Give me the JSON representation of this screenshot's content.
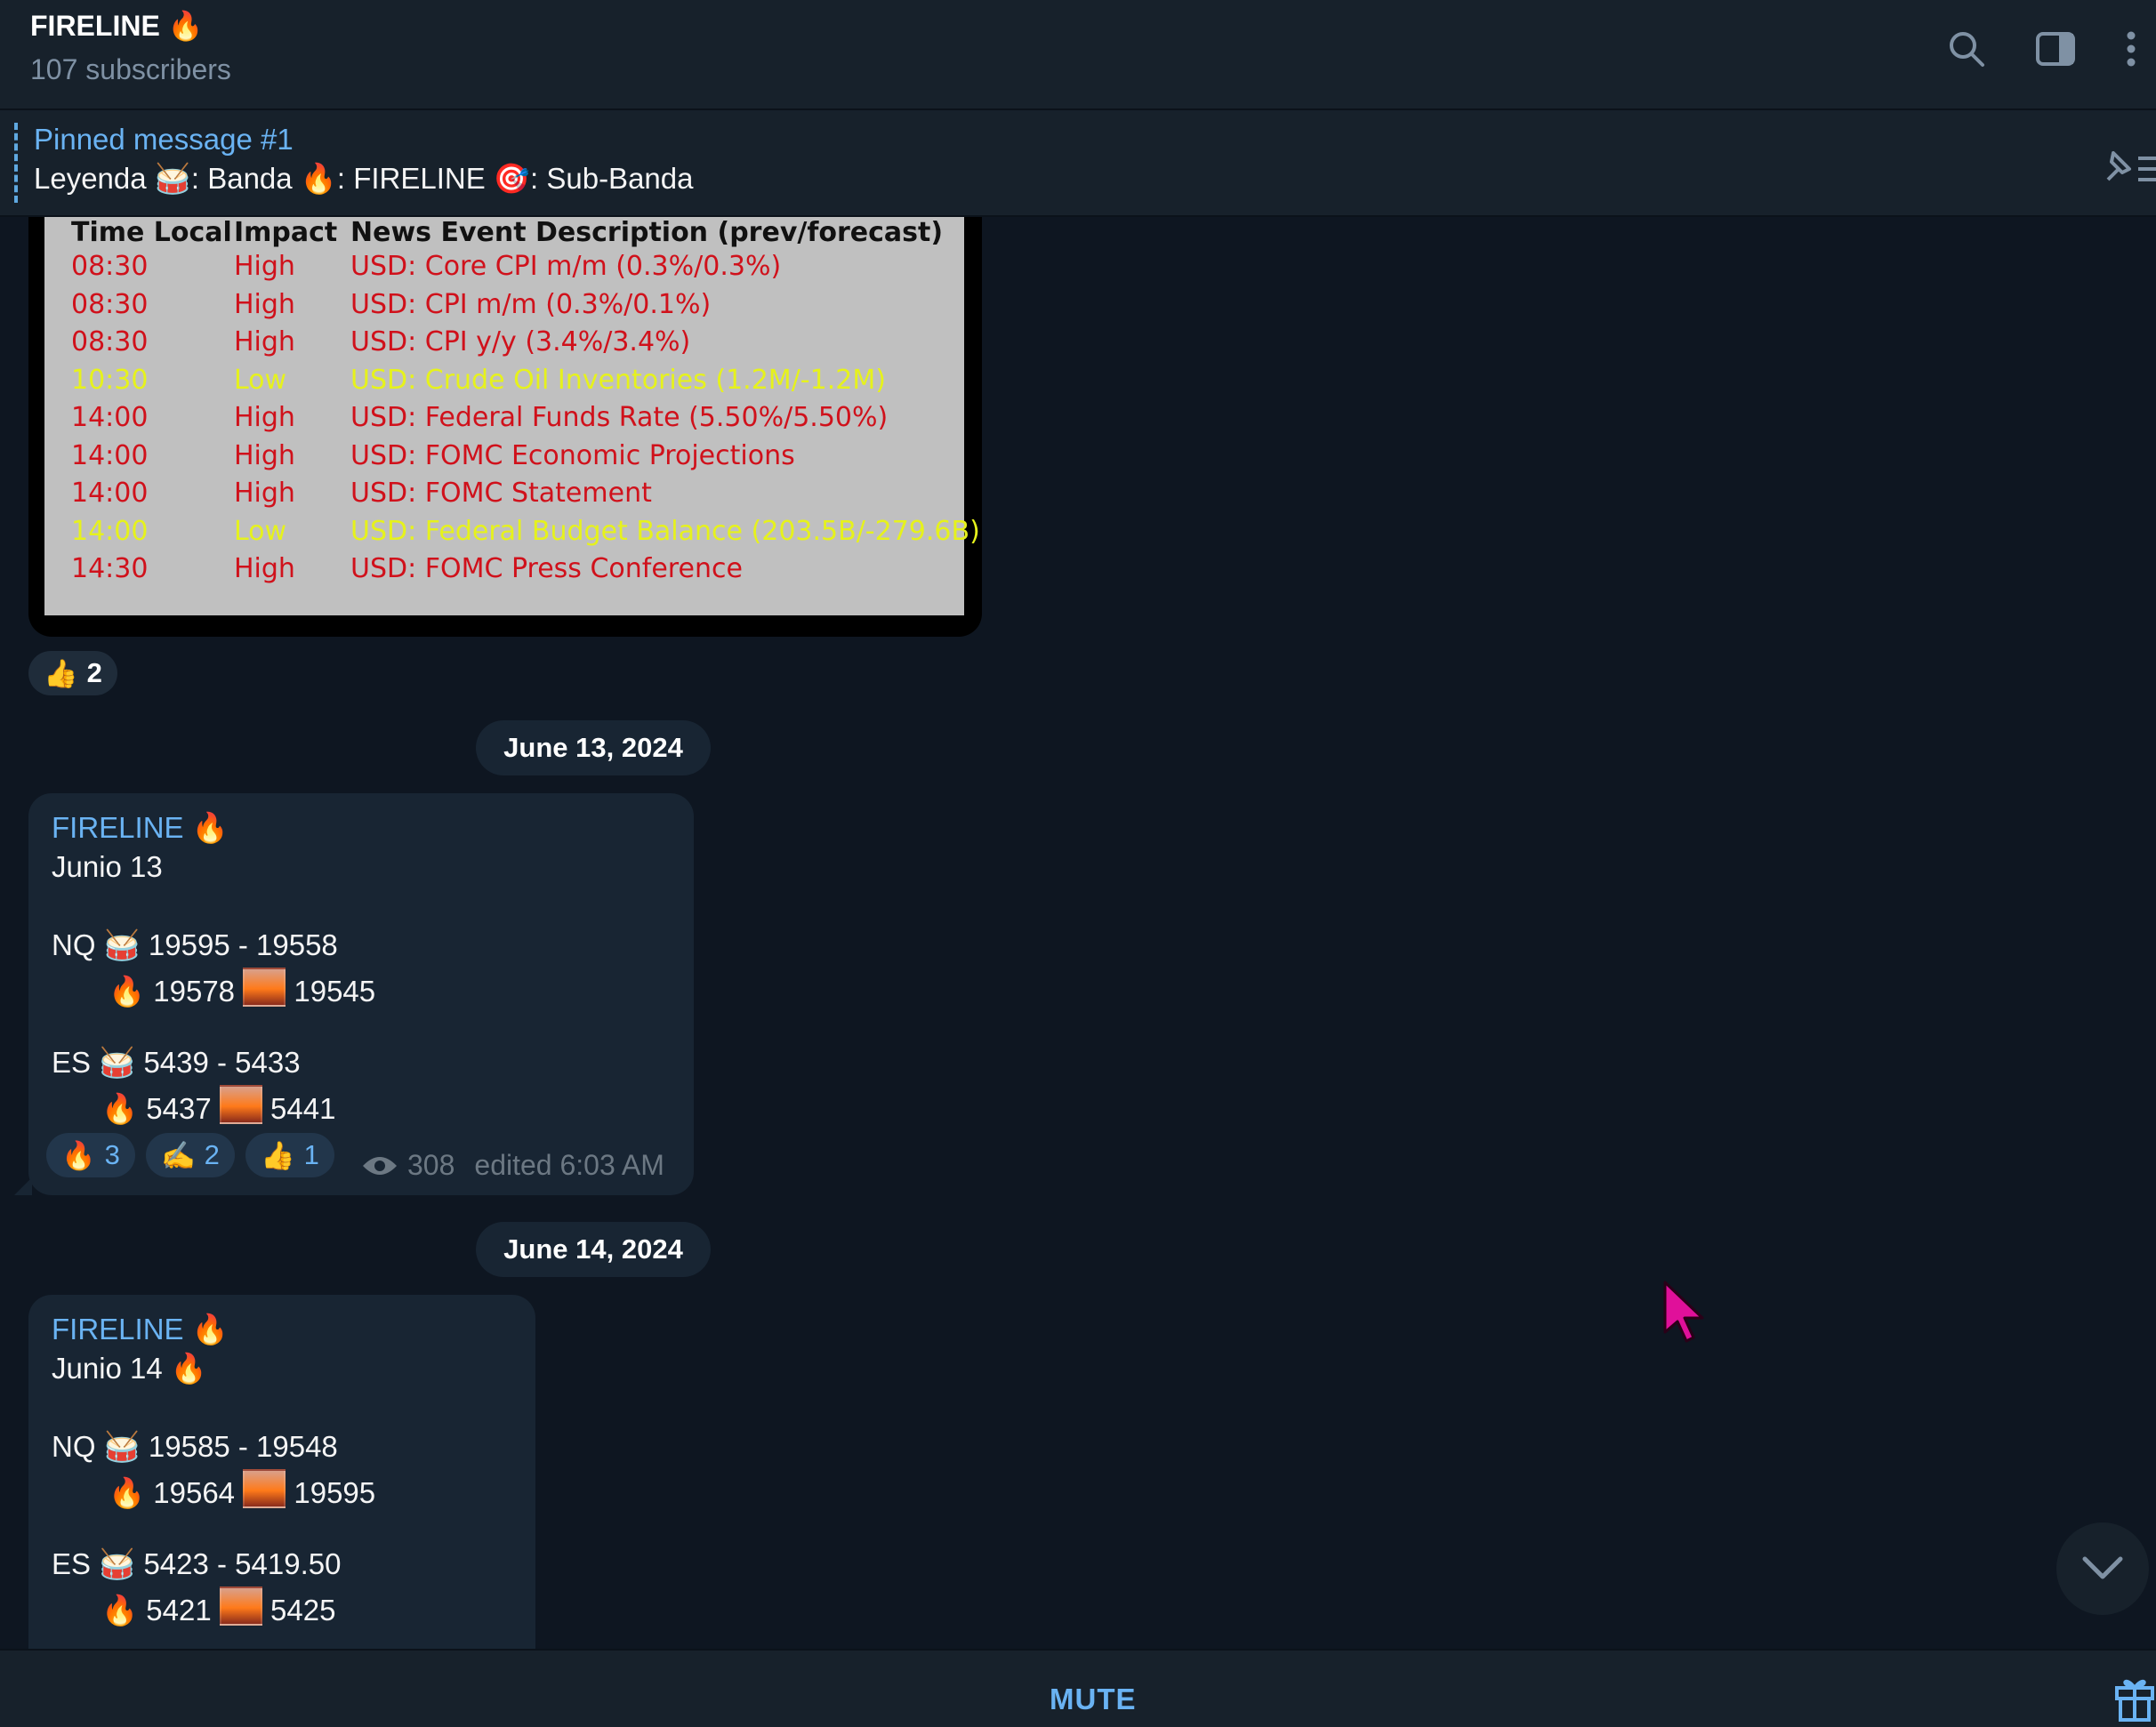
{
  "header": {
    "title": "FIRELINE 🔥",
    "subtitle": "107 subscribers",
    "icons": [
      "search-icon",
      "sidebar-toggle-icon",
      "more-vert-icon"
    ]
  },
  "pinned": {
    "title": "Pinned message #1",
    "text": "Leyenda 🥁: Banda  🔥: FIRELINE  🎯: Sub-Banda"
  },
  "news_table": {
    "headers": [
      "Time Local",
      "Impact",
      "News Event Description (prev/forecast)"
    ],
    "rows": [
      {
        "time": "08:30",
        "impact": "High",
        "desc": "USD: Core CPI m/m (0.3%/0.3%)",
        "level": "high"
      },
      {
        "time": "08:30",
        "impact": "High",
        "desc": "USD: CPI m/m (0.3%/0.1%)",
        "level": "high"
      },
      {
        "time": "08:30",
        "impact": "High",
        "desc": "USD: CPI y/y (3.4%/3.4%)",
        "level": "high"
      },
      {
        "time": "10:30",
        "impact": "Low",
        "desc": "USD: Crude Oil Inventories (1.2M/-1.2M)",
        "level": "low"
      },
      {
        "time": "14:00",
        "impact": "High",
        "desc": "USD: Federal Funds Rate (5.50%/5.50%)",
        "level": "high"
      },
      {
        "time": "14:00",
        "impact": "High",
        "desc": "USD: FOMC Economic Projections",
        "level": "high"
      },
      {
        "time": "14:00",
        "impact": "High",
        "desc": "USD: FOMC Statement",
        "level": "high"
      },
      {
        "time": "14:00",
        "impact": "Low",
        "desc": "USD: Federal Budget Balance (203.5B/-279.6B)",
        "level": "low"
      },
      {
        "time": "14:30",
        "impact": "High",
        "desc": "USD: FOMC Press Conference",
        "level": "high"
      }
    ]
  },
  "image_reaction": {
    "emoji": "👍",
    "count": "2"
  },
  "messages": [
    {
      "date": "June 13, 2024",
      "sender": "FIRELINE 🔥",
      "title": "Junio 13",
      "nq_label": "NQ 🥁 19595 - 19558",
      "nq_a": "19578",
      "nq_b": "19545",
      "es_label": "ES 🥁 5439 - 5433",
      "es_a": "5437",
      "es_b": "5441",
      "reactions": [
        {
          "emoji": "🔥",
          "count": "3"
        },
        {
          "emoji": "✍️",
          "count": "2"
        },
        {
          "emoji": "👍",
          "count": "1"
        }
      ],
      "views": "308",
      "edited": "edited 6:03 AM"
    },
    {
      "date": "June 14, 2024",
      "sender": "FIRELINE 🔥",
      "title": "Junio 14 🔥",
      "nq_label": "NQ 🥁 19585 - 19548",
      "nq_a": "19564",
      "nq_b": "19595",
      "es_label": "ES 🥁 5423 - 5419.50",
      "es_a": "5421",
      "es_b": "5425"
    }
  ],
  "footer": {
    "mute_label": "MUTE"
  },
  "colors": {
    "high": "#d0111b",
    "low": "#e6f21c",
    "accent": "#6ab3f3"
  }
}
